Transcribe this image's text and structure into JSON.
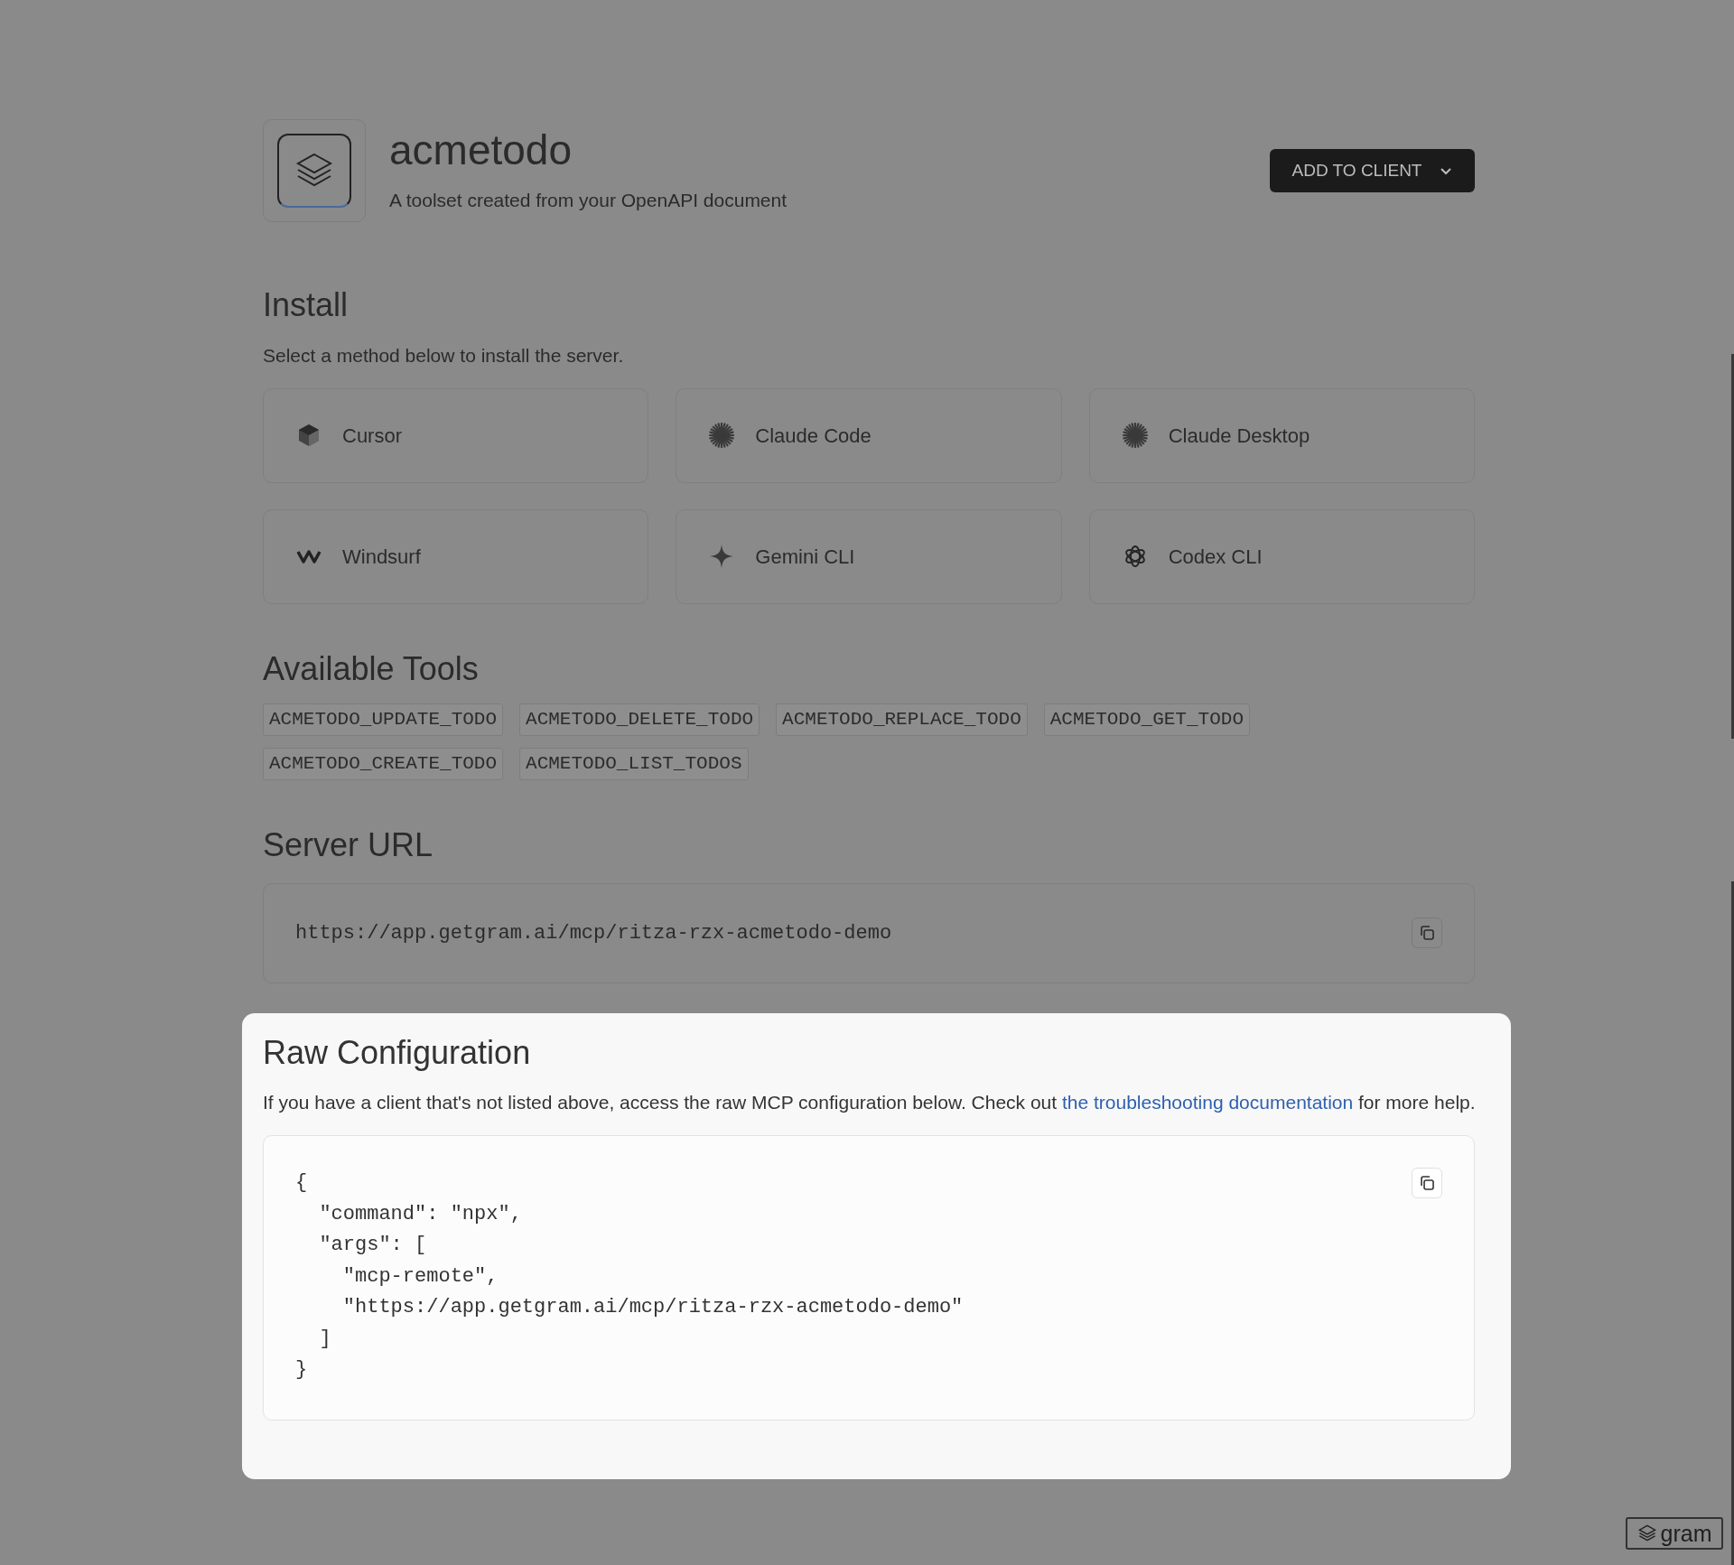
{
  "toolset": {
    "name": "acmetodo",
    "description": "A toolset created from your OpenAPI document",
    "action_button": "ADD TO CLIENT"
  },
  "install": {
    "title": "Install",
    "subtitle": "Select a method below to install the server.",
    "clients": [
      {
        "label": "Cursor",
        "kind": "cube"
      },
      {
        "label": "Claude Code",
        "kind": "burst"
      },
      {
        "label": "Claude Desktop",
        "kind": "burst"
      },
      {
        "label": "Windsurf",
        "kind": "wave"
      },
      {
        "label": "Gemini CLI",
        "kind": "sparkle"
      },
      {
        "label": "Codex CLI",
        "kind": "knot"
      }
    ]
  },
  "tools": {
    "title": "Available Tools",
    "items": [
      "ACMETODO_UPDATE_TODO",
      "ACMETODO_DELETE_TODO",
      "ACMETODO_REPLACE_TODO",
      "ACMETODO_GET_TODO",
      "ACMETODO_CREATE_TODO",
      "ACMETODO_LIST_TODOS"
    ]
  },
  "server_url": {
    "title": "Server URL",
    "value": "https://app.getgram.ai/mcp/ritza-rzx-acmetodo-demo"
  },
  "raw_configuration": {
    "title": "Raw Configuration",
    "text": "If you have a client that's not listed above, access the raw MCP configuration below. Check out",
    "link": "the troubleshooting documentation",
    "text_after": "for more help.",
    "code_lines": [
      "{",
      "  \"command\": \"npx\",",
      "  \"args\": [",
      "    \"mcp-remote\",",
      "    \"https://app.getgram.ai/mcp/ritza-rzx-acmetodo-demo\"",
      "  ]",
      "}"
    ]
  },
  "badge": {
    "label": "gram"
  }
}
